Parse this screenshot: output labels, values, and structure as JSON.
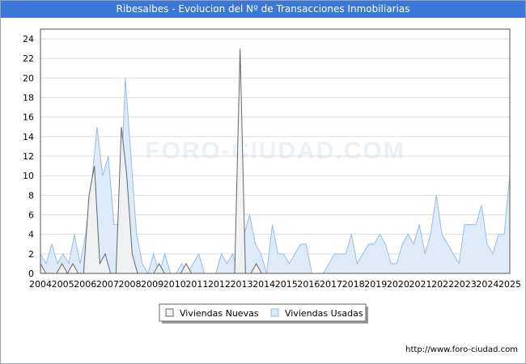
{
  "chart_data": {
    "type": "area",
    "title": "Ribesalbes - Evolucion del Nº de Transacciones Inmobiliarias",
    "watermark": "FORO-CIUDAD.COM",
    "xlabel": "",
    "ylabel": "",
    "ylim": [
      0,
      25
    ],
    "y_ticks": [
      0,
      2,
      4,
      6,
      8,
      10,
      12,
      14,
      16,
      18,
      20,
      22,
      24
    ],
    "x_range": [
      2004,
      2025
    ],
    "x_ticks": [
      "2004",
      "2005",
      "2006",
      "2007",
      "2008",
      "2009",
      "2010",
      "2011",
      "2012",
      "2013",
      "2014",
      "2015",
      "2016",
      "2017",
      "2018",
      "2019",
      "2020",
      "2021",
      "2022",
      "2023",
      "2024",
      "2025"
    ],
    "grid": true,
    "legend_position": "bottom-center",
    "series": [
      {
        "name": "Viviendas Nuevas",
        "color": "#666666",
        "fill": "#f2f2f2",
        "values": [
          1,
          0,
          0,
          0,
          1,
          0,
          1,
          0,
          0,
          8,
          11,
          1,
          2,
          0,
          0,
          15,
          10,
          2,
          0,
          0,
          0,
          0,
          1,
          0,
          0,
          0,
          0,
          1,
          0,
          0,
          0,
          0,
          0,
          0,
          0,
          0,
          0,
          23,
          0,
          0,
          1,
          0,
          0,
          0,
          0,
          0,
          0,
          0,
          0,
          0,
          0,
          0,
          0,
          0,
          0,
          0,
          0,
          0,
          0,
          0,
          0,
          0,
          0,
          0,
          0,
          0,
          0,
          0,
          0,
          0,
          0,
          0,
          0,
          0,
          0,
          0,
          0,
          0,
          0,
          0,
          0,
          0,
          0,
          0,
          0,
          0,
          0,
          0
        ]
      },
      {
        "name": "Viviendas Usadas",
        "color": "#9bbce0",
        "fill": "#ddeaf8",
        "values": [
          2,
          1,
          3,
          1,
          2,
          1,
          4,
          1,
          4,
          9,
          15,
          10,
          12,
          5,
          5,
          20,
          12,
          4,
          1,
          0,
          2,
          0,
          2,
          0,
          0,
          1,
          0,
          1,
          2,
          0,
          0,
          0,
          2,
          1,
          2,
          0,
          4,
          6,
          3,
          2,
          0,
          5,
          2,
          2,
          1,
          2,
          3,
          3,
          0,
          0,
          0,
          1,
          2,
          2,
          2,
          4,
          1,
          2,
          3,
          3,
          4,
          3,
          1,
          1,
          3,
          4,
          3,
          5,
          2,
          4,
          8,
          4,
          3,
          2,
          1,
          5,
          5,
          5,
          7,
          3,
          2,
          4,
          4,
          10
        ]
      }
    ]
  },
  "footer": {
    "url": "http://www.foro-ciudad.com"
  }
}
